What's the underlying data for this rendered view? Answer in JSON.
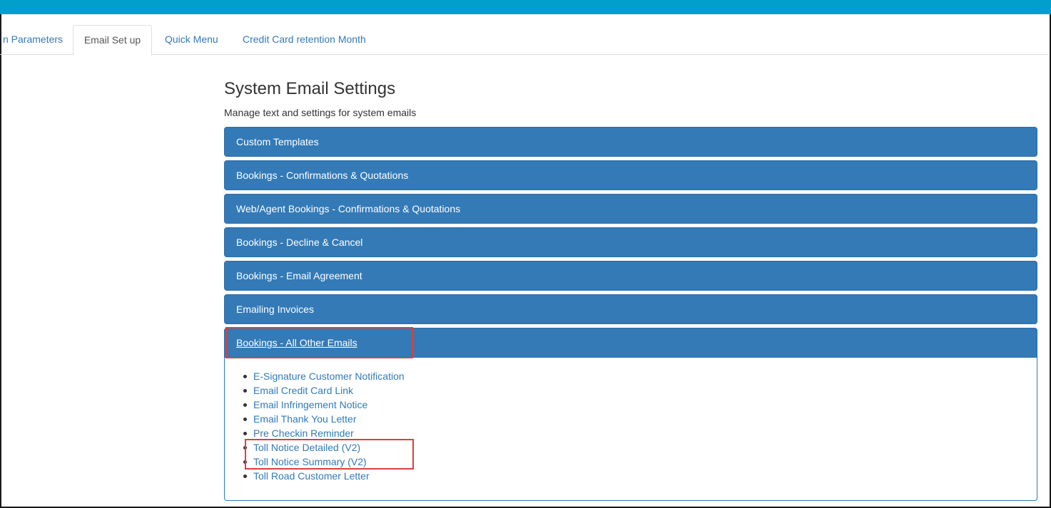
{
  "tabs": [
    {
      "label": "n Parameters",
      "active": false
    },
    {
      "label": "Email Set up",
      "active": true
    },
    {
      "label": "Quick Menu",
      "active": false
    },
    {
      "label": "Credit Card retention Month",
      "active": false
    }
  ],
  "page": {
    "title": "System Email Settings",
    "subtitle": "Manage text and settings for system emails"
  },
  "panels": [
    {
      "label": "Custom Templates",
      "expanded": false
    },
    {
      "label": "Bookings - Confirmations & Quotations",
      "expanded": false
    },
    {
      "label": "Web/Agent Bookings - Confirmations & Quotations",
      "expanded": false
    },
    {
      "label": "Bookings - Decline & Cancel",
      "expanded": false
    },
    {
      "label": "Bookings - Email Agreement",
      "expanded": false
    },
    {
      "label": "Emailing Invoices",
      "expanded": false
    },
    {
      "label": "Bookings - All Other Emails",
      "expanded": true
    }
  ],
  "expanded_items": [
    "E-Signature Customer Notification",
    "Email Credit Card Link",
    "Email Infringement Notice",
    "Email Thank You Letter",
    "Pre Checkin Reminder",
    "Toll Notice Detailed (V2)",
    "Toll Notice Summary (V2)",
    "Toll Road Customer Letter"
  ],
  "colors": {
    "topbar": "#009fcc",
    "panel": "#337ab7",
    "link": "#337ab7",
    "highlight": "#d9413a"
  }
}
